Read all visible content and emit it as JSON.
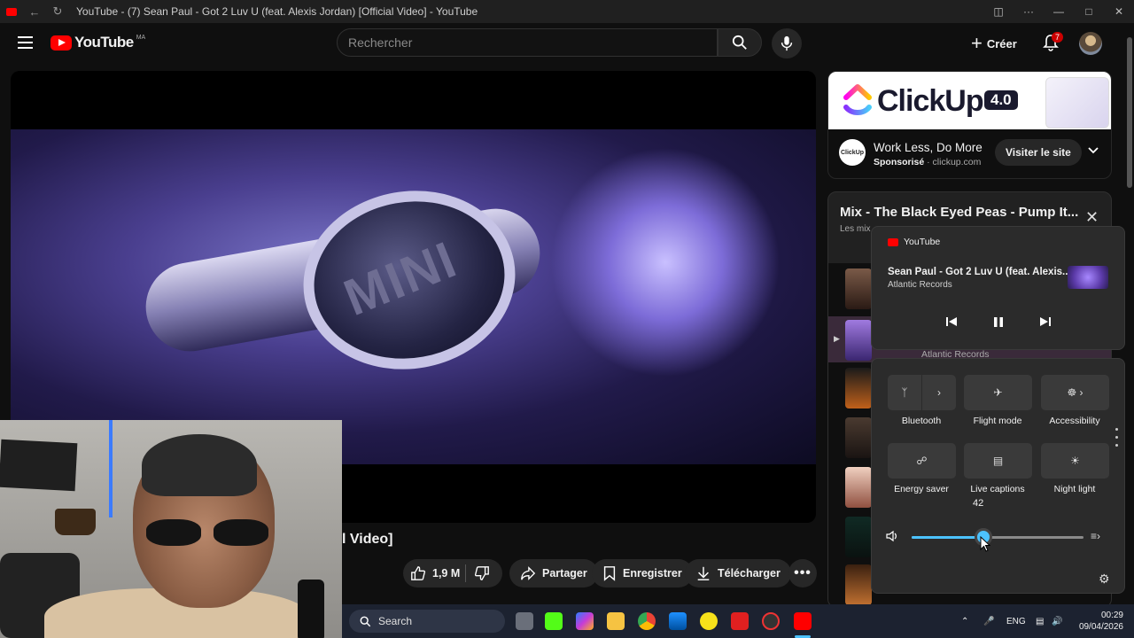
{
  "window": {
    "title": "YouTube - (7) Sean Paul - Got 2 Luv U (feat. Alexis Jordan) [Official Video] - YouTube"
  },
  "header": {
    "logo_text": "YouTube",
    "country_code": "MA",
    "search_placeholder": "Rechercher",
    "create_label": "Créer",
    "notification_count": "7"
  },
  "video": {
    "title_visible": "l Video]",
    "emblem_text": "MINI",
    "actions": {
      "like_count": "1,9 M",
      "share_label": "Partager",
      "save_label": "Enregistrer",
      "download_label": "Télécharger"
    }
  },
  "ad": {
    "brand": "ClickUp",
    "version": "4.0",
    "icon_text": "ClickUp",
    "title": "Work Less, Do More",
    "sponsored": "Sponsorisé",
    "domain": "· clickup.com",
    "visit_label": "Visiter le site"
  },
  "mix": {
    "title": "Mix - The Black Eyed Peas - Pump It...",
    "subtitle": "Les mix",
    "active_channel": "Atlantic Records"
  },
  "media_flyout": {
    "source": "YouTube",
    "song": "Sean Paul - Got 2 Luv U (feat. Alexis...",
    "artist": "Atlantic Records"
  },
  "quick_settings": {
    "tiles": [
      {
        "label": "Bluetooth"
      },
      {
        "label": "Flight mode"
      },
      {
        "label": "Accessibility"
      },
      {
        "label": "Energy saver"
      },
      {
        "label": "Live captions"
      },
      {
        "label": "Night light"
      }
    ],
    "volume": 42,
    "volume_label": "42"
  },
  "taskbar": {
    "search_label": "Search",
    "language": "ENG",
    "time": "00:29",
    "date": "09/04/2026"
  },
  "colors": {
    "youtube_red": "#ff0000",
    "accent_blue": "#4cc2ff",
    "background": "#0f0f0f"
  }
}
